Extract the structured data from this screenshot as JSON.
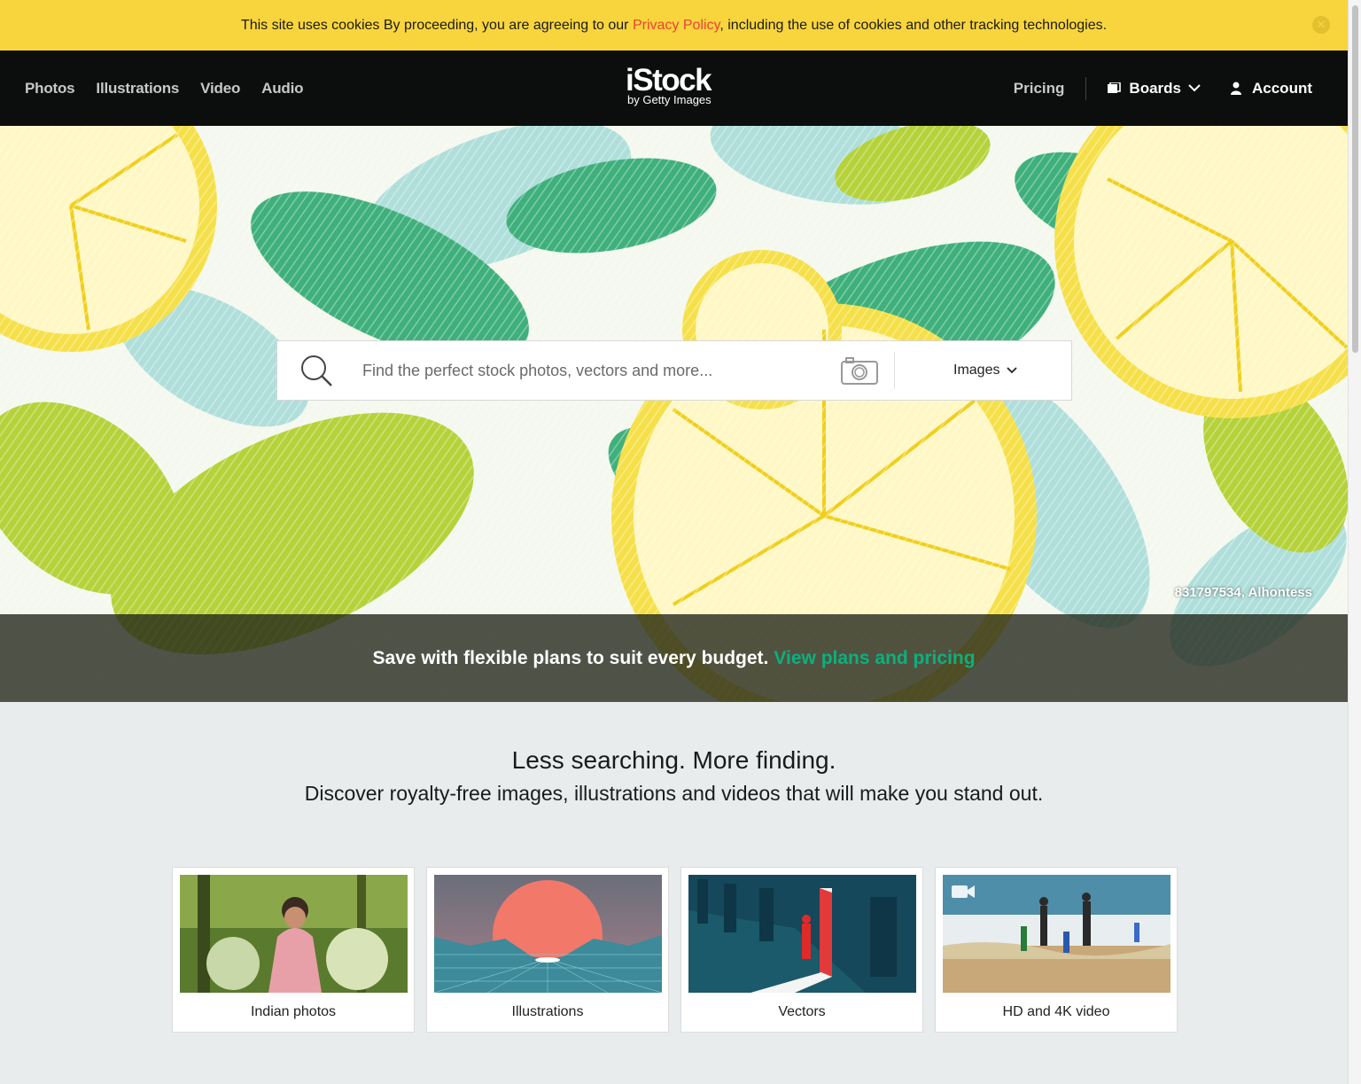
{
  "cookie_bar": {
    "text_before": "This site uses cookies By proceeding, you are agreeing to our ",
    "policy_link": "Privacy Policy",
    "text_after": ", including the use of cookies and other tracking technologies.",
    "close_label": "✕"
  },
  "header": {
    "nav": [
      "Photos",
      "Illustrations",
      "Video",
      "Audio"
    ],
    "logo": {
      "brand": "iStock",
      "sub": "by Getty Images"
    },
    "pricing": "Pricing",
    "boards": "Boards",
    "account": "Account"
  },
  "search": {
    "placeholder": "Find the perfect stock photos, vectors and more...",
    "type": "Images"
  },
  "hero": {
    "credit": "831797534, Alhontess",
    "promo_text": "Save with flexible plans to suit every budget.",
    "promo_link": "View plans and pricing"
  },
  "intro": {
    "heading": "Less searching. More finding.",
    "subheading": "Discover royalty-free images, illustrations and videos that will make you stand out."
  },
  "cards": [
    {
      "label": "Indian photos"
    },
    {
      "label": "Illustrations"
    },
    {
      "label": "Vectors"
    },
    {
      "label": "HD and 4K video"
    }
  ],
  "colors": {
    "cookie_bg": "#f8d53d",
    "link_red": "#ef4136",
    "header_bg": "#0c0d0d",
    "accent_green": "#0cb07f"
  }
}
